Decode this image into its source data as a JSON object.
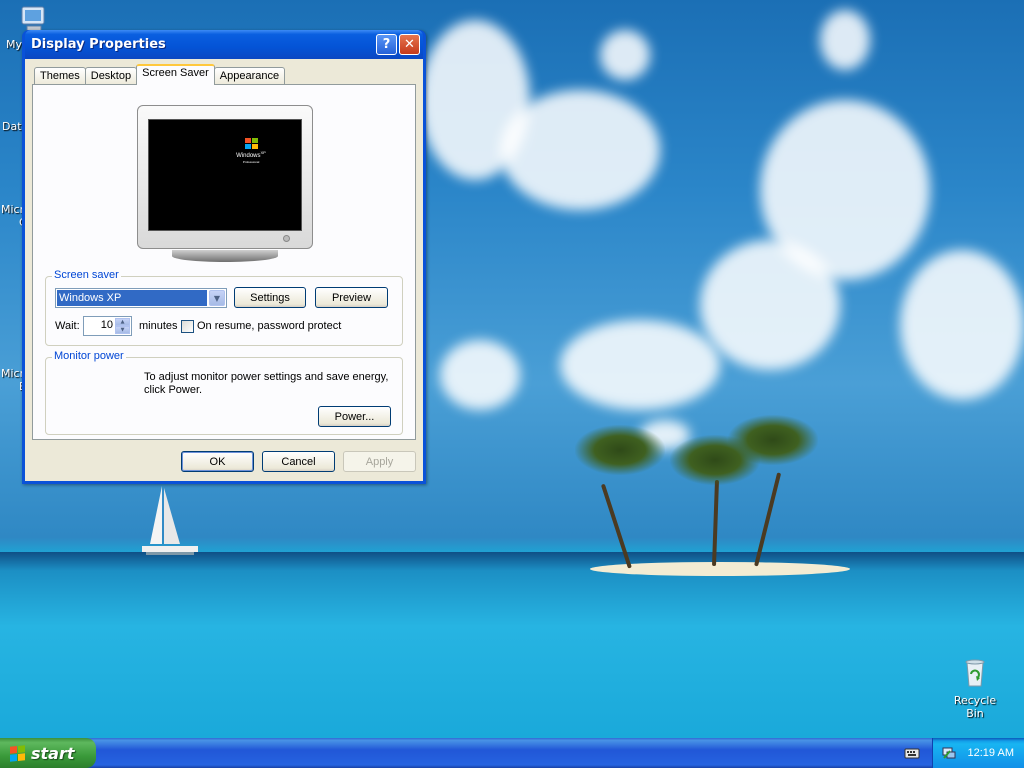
{
  "desktop": {
    "icons": [
      {
        "id": "my-computer",
        "label": "My"
      },
      {
        "id": "data",
        "label": "Dat"
      },
      {
        "id": "micro1",
        "label": "Micro"
      },
      {
        "id": "micro1b",
        "label": "C"
      },
      {
        "id": "micro2",
        "label": "Micro"
      },
      {
        "id": "micro2b",
        "label": "B"
      }
    ],
    "recycle_bin_label": "Recycle Bin"
  },
  "window": {
    "title": "Display Properties",
    "help_glyph": "?",
    "close_glyph": "✕",
    "tabs": [
      {
        "label": "Themes",
        "active": false
      },
      {
        "label": "Desktop",
        "active": false
      },
      {
        "label": "Screen Saver",
        "active": true
      },
      {
        "label": "Appearance",
        "active": false
      }
    ],
    "preview": {
      "logo_line1": "Windows",
      "logo_sup": "XP",
      "logo_line2": "Professional"
    },
    "screen_saver_group": {
      "legend": "Screen saver",
      "selected": "Windows XP",
      "settings_label": "Settings",
      "preview_label": "Preview",
      "wait_label": "Wait:",
      "wait_value": "10",
      "minutes_label": "minutes",
      "password_protect_label": "On resume, password protect",
      "password_protect_checked": false
    },
    "monitor_power_group": {
      "legend": "Monitor power",
      "description_line1": "To adjust monitor power settings and save energy,",
      "description_line2": "click Power.",
      "power_label": "Power..."
    },
    "buttons": {
      "ok": "OK",
      "cancel": "Cancel",
      "apply": "Apply"
    }
  },
  "taskbar": {
    "start_label": "start",
    "clock": "12:19 AM"
  },
  "colors": {
    "title_bar": "#0453d6",
    "dialog_face": "#ece9d8",
    "group_legend": "#0046d5",
    "selection": "#316ac5",
    "start_green": "#3a9a3a",
    "tray_blue": "#139beb"
  }
}
